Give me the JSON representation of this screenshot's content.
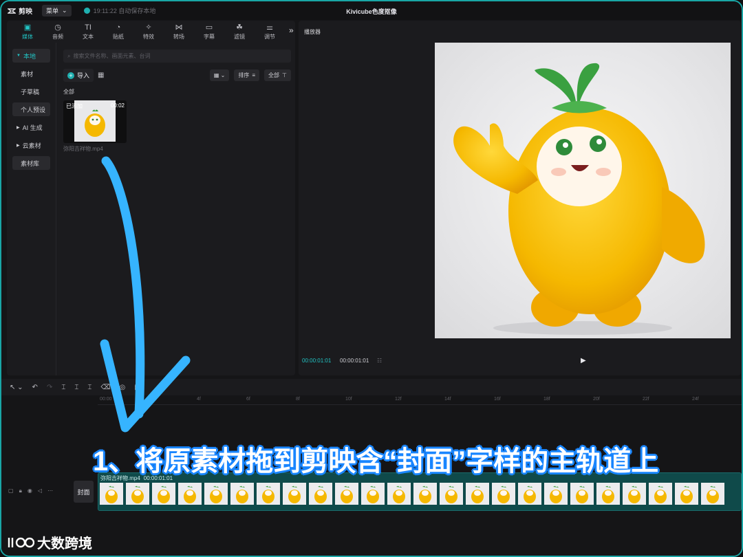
{
  "app": {
    "name": "剪映",
    "menu_label": "菜单",
    "save_status": "19:11:22 自动保存本地",
    "window_title": "Kivicube色度抠像"
  },
  "media_tabs": [
    {
      "label": "媒体",
      "icon": "media-icon",
      "active": true
    },
    {
      "label": "音频",
      "icon": "audio-icon"
    },
    {
      "label": "文本",
      "icon": "text-icon"
    },
    {
      "label": "贴纸",
      "icon": "sticker-icon"
    },
    {
      "label": "特效",
      "icon": "effects-icon"
    },
    {
      "label": "转场",
      "icon": "transition-icon"
    },
    {
      "label": "字幕",
      "icon": "subtitle-icon"
    },
    {
      "label": "滤镜",
      "icon": "filter-icon"
    },
    {
      "label": "调节",
      "icon": "adjust-icon"
    }
  ],
  "sidebar": {
    "items": [
      {
        "label": "本地",
        "state": "active"
      },
      {
        "label": "素材",
        "state": "plain"
      },
      {
        "label": "子草稿",
        "state": "plain"
      },
      {
        "label": "个人预设",
        "state": "filled"
      },
      {
        "label": "AI 生成",
        "state": "plain"
      },
      {
        "label": "云素材",
        "state": "plain"
      },
      {
        "label": "素材库",
        "state": "filled"
      }
    ]
  },
  "media": {
    "search_placeholder": "搜索文件名称、画面元素、台词",
    "import_label": "导入",
    "sort_label": "排序",
    "filter_label": "全部",
    "section_label": "全部",
    "asset": {
      "badge": "已添加",
      "duration": "00:02",
      "name": "弥阳吉祥物.mp4"
    }
  },
  "player": {
    "title": "播放器",
    "current_time": "00:00:01:01",
    "total_time": "00:00:01:01"
  },
  "timeline": {
    "ruler_ticks": [
      "00:00",
      "4f",
      "6f",
      "8f",
      "10f",
      "12f",
      "14f",
      "16f",
      "18f",
      "20f",
      "22f",
      "24f"
    ],
    "cover_label": "封面",
    "clip_name": "弥阳吉祥物.mp4",
    "clip_duration": "00:00:01:01"
  },
  "overlay": {
    "caption": "1、将原素材拖到剪映含“封面”字样的主轨道上",
    "watermark": "大数跨境"
  },
  "colors": {
    "accent": "#22c4c4",
    "arrow": "#36b4ff",
    "caption_stroke": "#1a86ff",
    "mascot_yellow": "#f5b800"
  }
}
